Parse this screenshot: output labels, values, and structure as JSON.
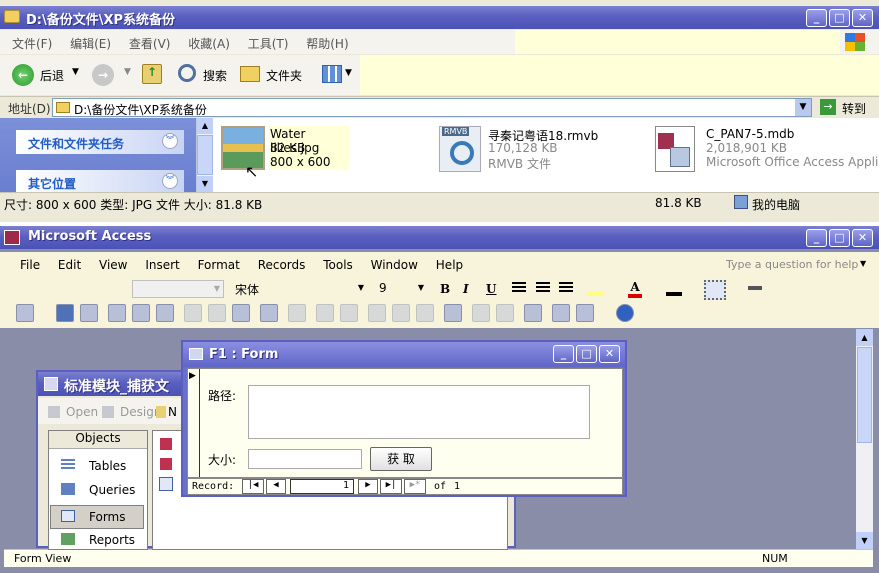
{
  "explorer": {
    "title": "D:\\备份文件\\XP系统备份",
    "menu": [
      "文件(F)",
      "编辑(E)",
      "查看(V)",
      "收藏(A)",
      "工具(T)",
      "帮助(H)"
    ],
    "back_label": "后退",
    "search_label": "搜索",
    "folders_label": "文件夹",
    "address_label": "地址(D)",
    "address_value": "D:\\备份文件\\XP系统备份",
    "go_label": "转到",
    "task_panels": [
      "文件和文件夹任务",
      "其它位置"
    ],
    "files": [
      {
        "name": "Water lilies.jpg",
        "line2": "82 KB",
        "line3": "800 x 600"
      },
      {
        "name": "寻秦记粤语18.rmvb",
        "line2": "170,128 KB",
        "line3": "RMVB 文件"
      },
      {
        "name": "C_PAN7-5.mdb",
        "line2": "2,018,901 KB",
        "line3": "Microsoft Office Access Applic..."
      }
    ],
    "status_info": "尺寸: 800 x 600 类型: JPG 文件 大小: 81.8 KB",
    "status_size": "81.8 KB",
    "status_location": "我的电脑",
    "rmvb_badge": "RMVB"
  },
  "access": {
    "title": "Microsoft Access",
    "menu": [
      "File",
      "Edit",
      "View",
      "Insert",
      "Format",
      "Records",
      "Tools",
      "Window",
      "Help"
    ],
    "help_placeholder": "Type a question for help",
    "font_name": "宋体",
    "font_size": "9",
    "bold": "B",
    "italic": "I",
    "underline": "U",
    "status_left": "Form View",
    "status_right": "NUM"
  },
  "db_window": {
    "title": "标准模块_捕获文",
    "open_label": "Open",
    "design_label": "Design",
    "new_label": "N",
    "objects_header": "Objects",
    "objects": [
      "Tables",
      "Queries",
      "Forms",
      "Reports"
    ]
  },
  "form": {
    "title": "F1 : Form",
    "path_label": "路径:",
    "size_label": "大小:",
    "get_button": "获 取",
    "record_label": "Record:",
    "record_value": "1",
    "of_label": "of",
    "record_total": "1"
  }
}
